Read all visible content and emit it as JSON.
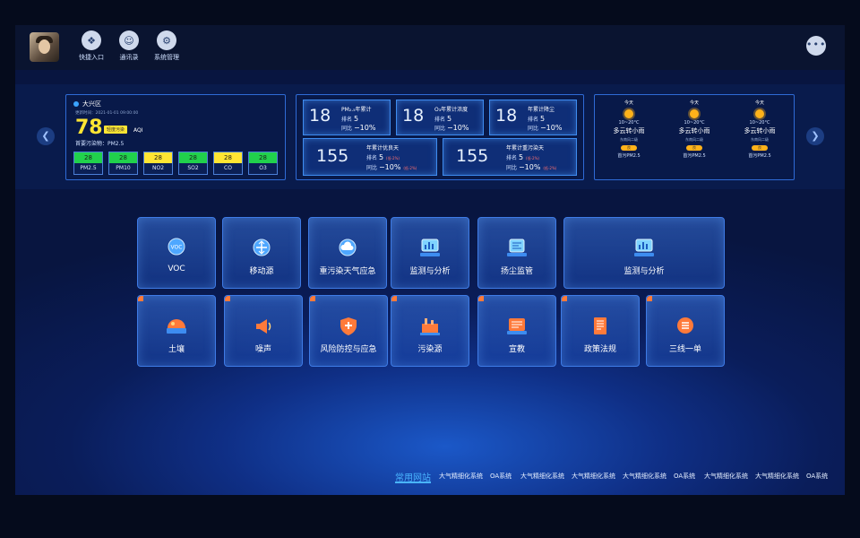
{
  "nav": {
    "items": [
      {
        "label": "快捷入口",
        "icon": "quick-entry-icon"
      },
      {
        "label": "通讯录",
        "icon": "contacts-icon"
      },
      {
        "label": "系统管理",
        "icon": "settings-icon"
      }
    ],
    "more_icon": "more-icon"
  },
  "aqi": {
    "location": "大兴区",
    "update_time": "更新时间：2021-01-01 09:00:00",
    "value": "78",
    "level": "轻度污染",
    "unit": "AQI",
    "primary": "首要污染物：PM2.5",
    "pollutants": [
      {
        "name": "PM2.5",
        "value": "28",
        "color": "#21d14c"
      },
      {
        "name": "PM10",
        "value": "28",
        "color": "#21d14c"
      },
      {
        "name": "NO2",
        "value": "28",
        "color": "#ffe533"
      },
      {
        "name": "SO2",
        "value": "28",
        "color": "#21d14c"
      },
      {
        "name": "CO",
        "value": "28",
        "color": "#ffe533"
      },
      {
        "name": "O3",
        "value": "28",
        "color": "#21d14c"
      }
    ]
  },
  "stats": {
    "top": [
      {
        "num": "18",
        "title": "PM₂.₅年累计",
        "rank_label": "排名",
        "rank": "5",
        "yoy_label": "同比",
        "yoy": "−10%"
      },
      {
        "num": "18",
        "title": "O₃年累计浓度",
        "rank_label": "排名",
        "rank": "5",
        "yoy_label": "同比",
        "yoy": "−10%"
      },
      {
        "num": "18",
        "title": "年累计降尘",
        "rank_label": "排名",
        "rank": "5",
        "yoy_label": "同比",
        "yoy": "−10%"
      }
    ],
    "bottom": [
      {
        "num": "155",
        "title": "年累计优良天",
        "rank_label": "排名",
        "rank": "5",
        "rank_tag": "(低-2%)",
        "yoy_label": "同比",
        "yoy": "−10%",
        "yoy_tag": "(低-2%)"
      },
      {
        "num": "155",
        "title": "年累计重污染天",
        "rank_label": "排名",
        "rank": "5",
        "rank_tag": "(低-2%)",
        "yoy_label": "同比",
        "yoy": "−10%",
        "yoy_tag": "(低-2%)"
      }
    ]
  },
  "weather": [
    {
      "day": "今天",
      "temp": "10~20°C",
      "desc": "多云转小雨",
      "wind": "东南风二级",
      "quality": "良",
      "pollutant": "首污PM2.5"
    },
    {
      "day": "今天",
      "temp": "10~20°C",
      "desc": "多云转小雨",
      "wind": "东南风二级",
      "quality": "良",
      "pollutant": "首污PM2.5"
    },
    {
      "day": "今天",
      "temp": "10~20°C",
      "desc": "多云转小雨",
      "wind": "东南风二级",
      "quality": "良",
      "pollutant": "首污PM2.5"
    }
  ],
  "tiles": {
    "row1": [
      {
        "label": "VOC",
        "icon": "voc-icon"
      },
      {
        "label": "移动源",
        "icon": "mobile-source-icon"
      },
      {
        "label": "重污染天气应急",
        "icon": "heavy-pollution-weather-icon"
      },
      {
        "label": "监测与分析",
        "icon": "monitor-analysis-icon"
      },
      {
        "label": "扬尘监管",
        "icon": "dust-supervision-icon"
      },
      {
        "label": "监测与分析",
        "icon": "monitor-analysis-icon"
      }
    ],
    "row2": [
      {
        "label": "土壤",
        "icon": "soil-icon"
      },
      {
        "label": "噪声",
        "icon": "noise-icon"
      },
      {
        "label": "风险防控与应急",
        "icon": "risk-control-icon"
      },
      {
        "label": "污染源",
        "icon": "pollution-source-icon"
      },
      {
        "label": "宣教",
        "icon": "education-icon"
      },
      {
        "label": "政策法规",
        "icon": "policy-regulation-icon"
      },
      {
        "label": "三线一单",
        "icon": "three-lines-icon"
      }
    ]
  },
  "links": {
    "title": "常用网站",
    "items": [
      "大气精细化系统",
      "OA系统",
      "大气精细化系统",
      "大气精细化系统",
      "大气精细化系统",
      "OA系统",
      "大气精细化系统",
      "大气精细化系统",
      "OA系统"
    ]
  },
  "icons": {
    "prev": "chevron-left-icon",
    "next": "chevron-right-icon",
    "location": "location-pin-icon"
  }
}
